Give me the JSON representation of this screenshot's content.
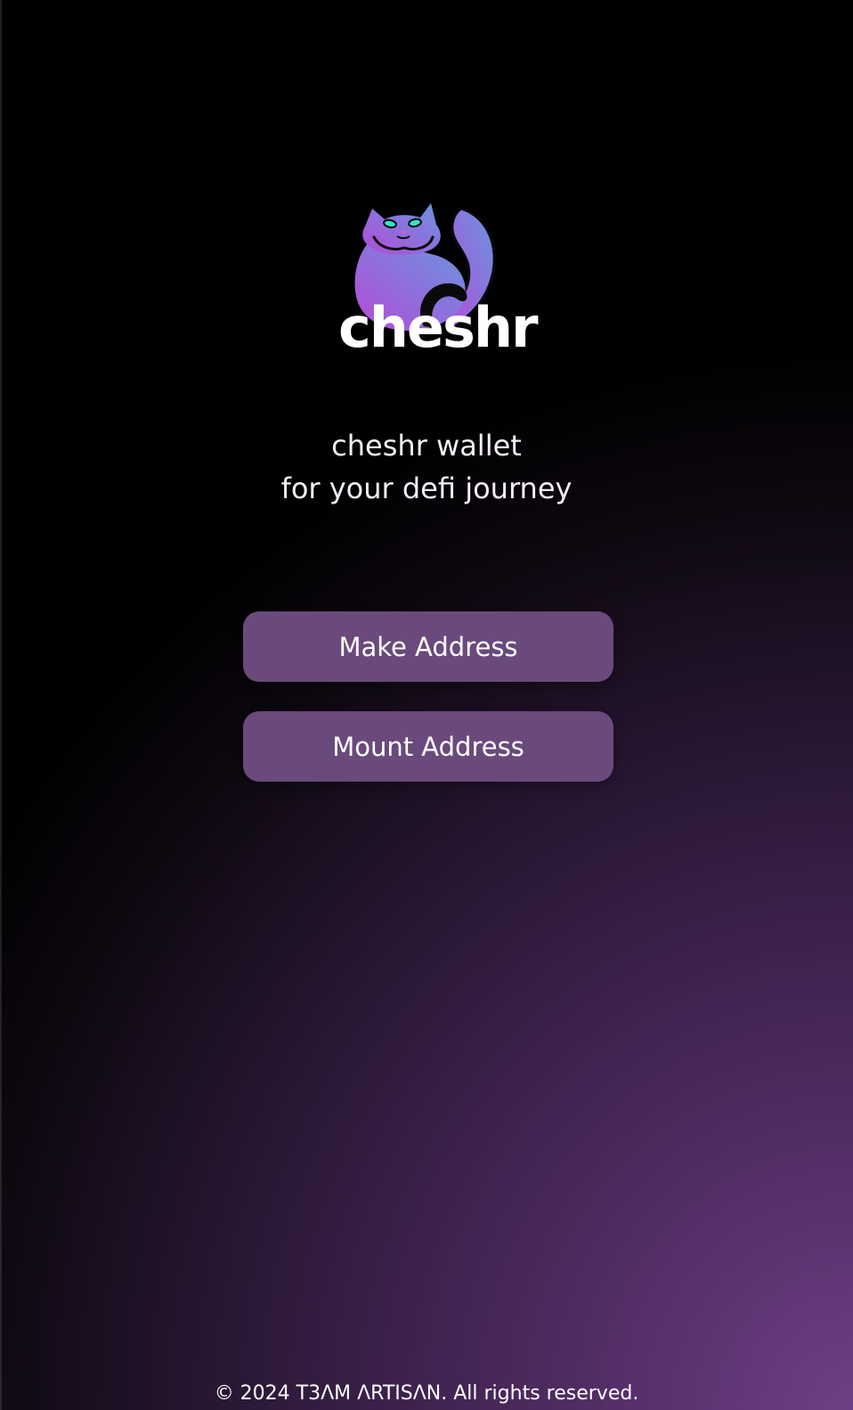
{
  "brand": {
    "name": "cheshr",
    "logo_icon": "cat-icon"
  },
  "tagline": {
    "line1": "cheshr wallet",
    "line2": "for your defi journey"
  },
  "actions": {
    "make_address_label": "Make Address",
    "mount_address_label": "Mount Address"
  },
  "footer": {
    "copyright": "© 2024 T3ΛM ΛRTISΛN. All rights reserved."
  },
  "colors": {
    "button_bg": "#6a4a7c",
    "gradient_light": "#6e3f84",
    "logo_gradient_start": "#b54bd8",
    "logo_gradient_end": "#6b95e0",
    "cat_eyes": "#2ee6c8"
  }
}
